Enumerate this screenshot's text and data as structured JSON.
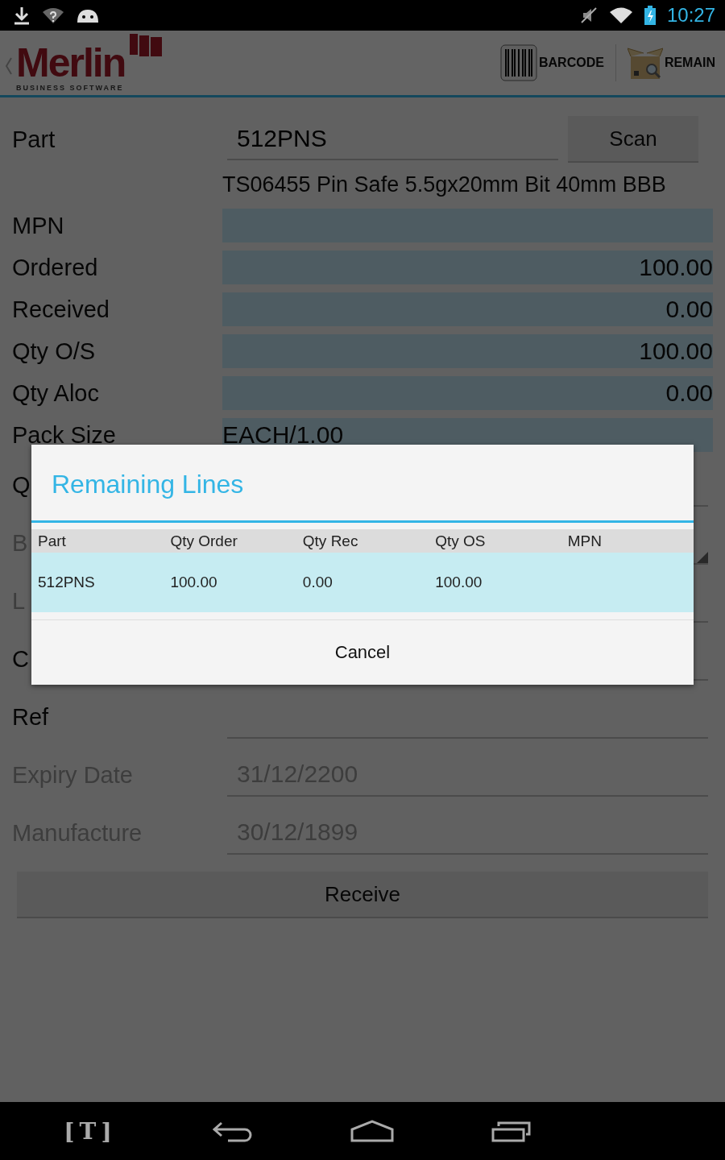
{
  "status_bar": {
    "time": "10:27"
  },
  "app_bar": {
    "logo": "Merlin",
    "logo_tagline": "BUSINESS SOFTWARE",
    "actions": [
      {
        "label": "BARCODE",
        "kind": "barcode"
      },
      {
        "label": "REMAIN",
        "kind": "box"
      }
    ]
  },
  "form": {
    "part": {
      "label": "Part",
      "value": "512PNS",
      "button": "Scan"
    },
    "description": "TS06455 Pin Safe 5.5gx20mm Bit 40mm BBB",
    "readonly_fields": [
      {
        "label": "MPN",
        "kind": "number"
      },
      {
        "label": "Ordered",
        "value": "100.00",
        "kind": "number"
      },
      {
        "label": "Received",
        "value": "0.00",
        "kind": "number"
      },
      {
        "label": "Qty O/S",
        "value": "100.00",
        "kind": "number"
      },
      {
        "label": "Qty Aloc",
        "value": "0.00",
        "kind": "number"
      },
      {
        "label": "Pack Size",
        "value": "EACH/1.00",
        "kind": "text"
      }
    ],
    "input_rows": [
      {
        "label": "Q",
        "kind": "input",
        "disabled": false
      },
      {
        "label": "B",
        "kind": "spinner",
        "disabled": true
      },
      {
        "label": "L",
        "kind": "input",
        "disabled": true
      },
      {
        "label": "C",
        "kind": "input",
        "disabled": false
      },
      {
        "label": "Ref",
        "kind": "input",
        "disabled": false
      },
      {
        "label": "Expiry Date",
        "value": "31/12/2200",
        "kind": "input",
        "disabled": true
      },
      {
        "label": "Manufacture",
        "value": "30/12/1899",
        "kind": "input",
        "disabled": true
      }
    ],
    "button": "Receive"
  },
  "dialog": {
    "title": "Remaining Lines",
    "columns": [
      "Part",
      "Qty Order",
      "Qty Rec",
      "Qty OS",
      "MPN"
    ],
    "rows": [
      {
        "cells": [
          "512PNS",
          "100.00",
          "0.00",
          "100.00",
          ""
        ],
        "selected": true
      }
    ],
    "button": "Cancel"
  },
  "nav_bar": {
    "ime_label": "[T]"
  }
}
